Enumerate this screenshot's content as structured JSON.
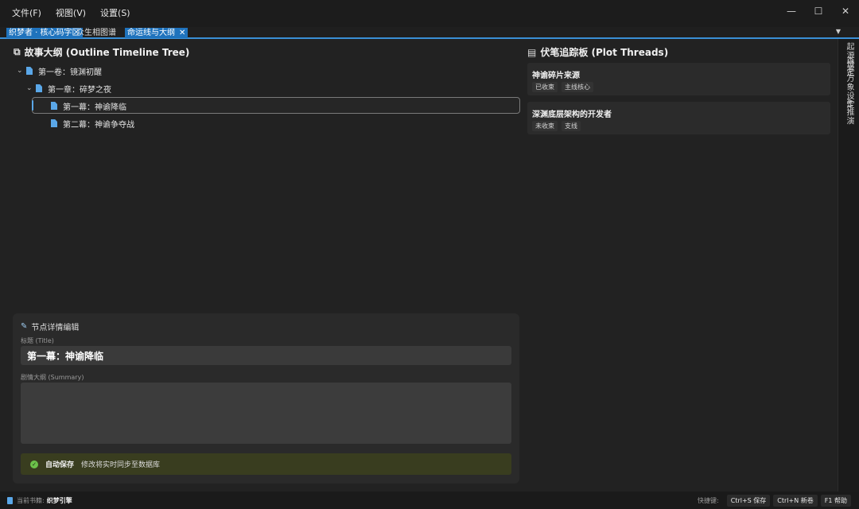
{
  "menu": [
    "文件(F)",
    "视图(V)",
    "设置(S)"
  ],
  "window_controls": {
    "minimize": "—",
    "maximize": "☐",
    "close": "✕"
  },
  "tabs": [
    {
      "label": "织梦者 · 核心码字区",
      "selected": true
    },
    {
      "label": "众生相图谱",
      "selected": false
    },
    {
      "label": "命运线与大纲",
      "selected": true,
      "close": "✕"
    }
  ],
  "tab_menu_glyph": "▼",
  "outline": {
    "heading": "故事大纲 (Outline Timeline Tree)",
    "items": [
      {
        "label": "第一卷：镜渊初醒",
        "level": 0,
        "expanded": true,
        "chevron": "⌄"
      },
      {
        "label": "第一章：碎梦之夜",
        "level": 1,
        "expanded": true,
        "chevron": "⌄"
      },
      {
        "label": "第一幕：神谕降临",
        "level": 2,
        "selected": true,
        "chevron": ""
      },
      {
        "label": "第二幕：神谕争夺战",
        "level": 2,
        "selected": false,
        "chevron": ""
      }
    ]
  },
  "threads": {
    "heading": "伏笔追踪板 (Plot Threads)",
    "items": [
      {
        "title": "神谕碎片来源",
        "tags": [
          "已收束",
          "主线核心"
        ]
      },
      {
        "title": "深渊底层架构的开发者",
        "tags": [
          "未收束",
          "支线"
        ]
      }
    ]
  },
  "side_tabs": [
    "起源设定",
    "森罗万象设定",
    "AI推演"
  ],
  "editor": {
    "heading": "节点详情编辑",
    "title_label": "标题 (Title)",
    "title_value": "第一幕：神谕降临",
    "summary_label": "剧情大纲 (Summary)",
    "summary_value": "",
    "autosave_title": "自动保存",
    "autosave_text": "修改将实时同步至数据库"
  },
  "status": {
    "current_label": "当前书籍:",
    "current_value": "织梦引擎",
    "shortcuts_label": "快捷键:",
    "shortcuts": [
      "Ctrl+S 保存",
      "Ctrl+N 新卷",
      "F1 帮助"
    ]
  },
  "colors": {
    "accent": "#1f73bd",
    "doc_icon": "#5aa7e8",
    "autosave_bg": "#393d1f",
    "check": "#6cc24a"
  }
}
